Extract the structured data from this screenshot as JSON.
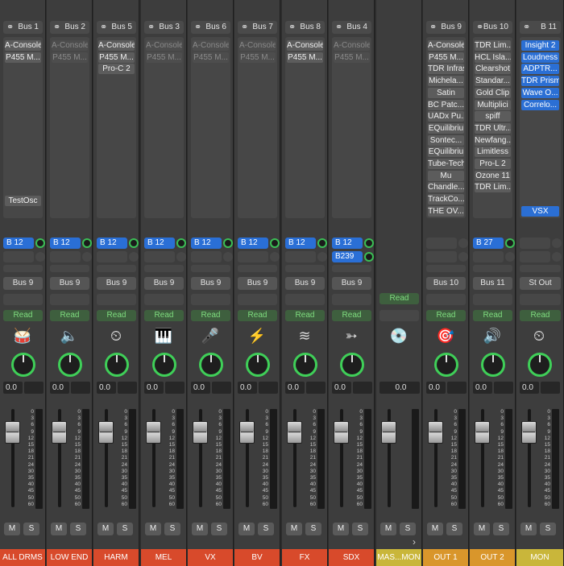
{
  "strips": [
    {
      "output": "Bus 1",
      "inserts": [
        {
          "label": "A-Console",
          "state": "on"
        },
        {
          "label": "P455 M...",
          "state": "on"
        }
      ],
      "extra_insert": "TestOsc",
      "sends": [
        {
          "label": "B 12"
        }
      ],
      "bus_out": "Bus 9",
      "automation": "Read",
      "icon": "drum-kit-icon",
      "icon_glyph": "🥁",
      "volume": "0.0",
      "name": "ALL DRMS",
      "name_color": "#d84a2b"
    },
    {
      "output": "Bus 2",
      "inserts": [
        {
          "label": "A-Console",
          "state": "bypassed"
        },
        {
          "label": "P455 M...",
          "state": "bypassed"
        }
      ],
      "sends": [
        {
          "label": "B 12"
        }
      ],
      "bus_out": "Bus 9",
      "automation": "Read",
      "icon": "amp-icon",
      "icon_glyph": "🔈",
      "volume": "0.0",
      "name": "LOW END",
      "name_color": "#d84a2b"
    },
    {
      "output": "Bus 5",
      "inserts": [
        {
          "label": "A-Console",
          "state": "on"
        },
        {
          "label": "P455 M...",
          "state": "on"
        },
        {
          "label": "Pro-C 2",
          "state": "on"
        }
      ],
      "sends": [
        {
          "label": "B 12"
        }
      ],
      "bus_out": "Bus 9",
      "automation": "Read",
      "icon": "gauge-icon",
      "icon_glyph": "⏲",
      "volume": "0.0",
      "name": "HARM",
      "name_color": "#d84a2b"
    },
    {
      "output": "Bus 3",
      "inserts": [
        {
          "label": "A-Console",
          "state": "bypassed"
        },
        {
          "label": "P455 M...",
          "state": "bypassed"
        }
      ],
      "sends": [
        {
          "label": "B 12"
        }
      ],
      "bus_out": "Bus 9",
      "automation": "Read",
      "icon": "keyboard-icon",
      "icon_glyph": "🎹",
      "volume": "0.0",
      "name": "MEL",
      "name_color": "#d84a2b"
    },
    {
      "output": "Bus 6",
      "inserts": [
        {
          "label": "A-Console",
          "state": "bypassed"
        },
        {
          "label": "P455 M...",
          "state": "bypassed"
        }
      ],
      "sends": [
        {
          "label": "B 12"
        }
      ],
      "bus_out": "Bus 9",
      "automation": "Read",
      "icon": "microphone-icon",
      "icon_glyph": "🎤",
      "volume": "0.0",
      "name": "VX",
      "name_color": "#d84a2b"
    },
    {
      "output": "Bus 7",
      "inserts": [
        {
          "label": "A-Console",
          "state": "bypassed"
        },
        {
          "label": "P455 M...",
          "state": "bypassed"
        }
      ],
      "sends": [
        {
          "label": "B 12"
        }
      ],
      "bus_out": "Bus 9",
      "automation": "Read",
      "icon": "lightning-icon",
      "icon_glyph": "⚡",
      "volume": "0.0",
      "name": "BV",
      "name_color": "#d84a2b"
    },
    {
      "output": "Bus 8",
      "inserts": [
        {
          "label": "A-Console",
          "state": "on"
        },
        {
          "label": "P455 M...",
          "state": "on"
        }
      ],
      "sends": [
        {
          "label": "B 12"
        }
      ],
      "bus_out": "Bus 9",
      "automation": "Read",
      "icon": "waves-icon",
      "icon_glyph": "≋",
      "volume": "0.0",
      "name": "FX",
      "name_color": "#d84a2b"
    },
    {
      "output": "Bus 4",
      "inserts": [
        {
          "label": "A-Console",
          "state": "bypassed"
        },
        {
          "label": "P455 M...",
          "state": "bypassed"
        }
      ],
      "sends": [
        {
          "label": "B 12"
        },
        {
          "label": "B239"
        }
      ],
      "bus_out": "Bus 9",
      "automation": "Read",
      "icon": "arrow-target-icon",
      "icon_glyph": "➳",
      "volume": "0.0",
      "name": "SDX",
      "name_color": "#d84a2b"
    },
    {
      "output": "",
      "inserts": [],
      "sends": [],
      "bus_out": "",
      "automation": "Read",
      "icon": "vinyl-icon",
      "icon_glyph": "💿",
      "volume": "0.0",
      "name": "MAS...MON",
      "name_color": "#c9b63a",
      "master": true
    },
    {
      "output": "Bus 9",
      "inserts": [
        {
          "label": "A-Console",
          "state": "on"
        },
        {
          "label": "P455 M...",
          "state": "on"
        },
        {
          "label": "TDR Infras",
          "state": "on"
        },
        {
          "label": "Michela...",
          "state": "on"
        },
        {
          "label": "Satin",
          "state": "on"
        },
        {
          "label": "BC Patc...",
          "state": "on"
        },
        {
          "label": "UADx Pu...",
          "state": "on"
        },
        {
          "label": "EQuilibriu",
          "state": "on"
        },
        {
          "label": "Sontec...",
          "state": "on"
        },
        {
          "label": "EQuilibriu",
          "state": "on"
        },
        {
          "label": "Tube-Tech",
          "state": "on"
        },
        {
          "label": "Mu",
          "state": "on"
        },
        {
          "label": "Chandle...",
          "state": "on"
        },
        {
          "label": "TrackCo...",
          "state": "on"
        },
        {
          "label": "THE OV...",
          "state": "on"
        }
      ],
      "sends": [],
      "bus_out": "Bus 10",
      "automation": "Read",
      "icon": "target-icon",
      "icon_glyph": "🎯",
      "volume": "0.0",
      "name": "OUT 1",
      "name_color": "#d9962b"
    },
    {
      "output": "Bus 10",
      "inserts": [
        {
          "label": "TDR Lim...",
          "state": "on"
        },
        {
          "label": "HCL Isla...",
          "state": "on"
        },
        {
          "label": "Clearshot",
          "state": "on"
        },
        {
          "label": "Standar...",
          "state": "on"
        },
        {
          "label": "Gold Clip",
          "state": "on"
        },
        {
          "label": "Multiplici",
          "state": "on"
        },
        {
          "label": "spiff",
          "state": "on"
        },
        {
          "label": "TDR Ultr...",
          "state": "on"
        },
        {
          "label": "Newfang...",
          "state": "on"
        },
        {
          "label": "Limitless",
          "state": "on"
        },
        {
          "label": "Pro-L 2",
          "state": "on"
        },
        {
          "label": "Ozone 11",
          "state": "on"
        },
        {
          "label": "TDR Lim...",
          "state": "on"
        }
      ],
      "sends": [
        {
          "label": "B 27"
        }
      ],
      "bus_out": "Bus 11",
      "automation": "Read",
      "icon": "speaker-icon",
      "icon_glyph": "🔊",
      "volume": "0.0",
      "name": "OUT 2",
      "name_color": "#d9962b"
    },
    {
      "output": "B 11",
      "inserts": [
        {
          "label": "Insight 2",
          "state": "blue"
        },
        {
          "label": "Loudness",
          "state": "blue"
        },
        {
          "label": "ADPTR...",
          "state": "blue"
        },
        {
          "label": "TDR Prism",
          "state": "blue"
        },
        {
          "label": "Wave O...",
          "state": "blue"
        },
        {
          "label": "Correlo...",
          "state": "blue"
        }
      ],
      "extra_insert": "VSX",
      "extra_blue": true,
      "sends": [],
      "bus_out": "St Out",
      "automation": "Read",
      "icon": "meter-icon",
      "icon_glyph": "⏲",
      "volume": "0.0",
      "name": "MON",
      "name_color": "#c9b63a"
    }
  ],
  "fader_scale": [
    "0",
    "3",
    "6",
    "9",
    "12",
    "15",
    "18",
    "21",
    "24",
    "30",
    "35",
    "40",
    "45",
    "50",
    "60"
  ],
  "mute_label": "M",
  "solo_label": "S",
  "scroll_arrow": "›"
}
